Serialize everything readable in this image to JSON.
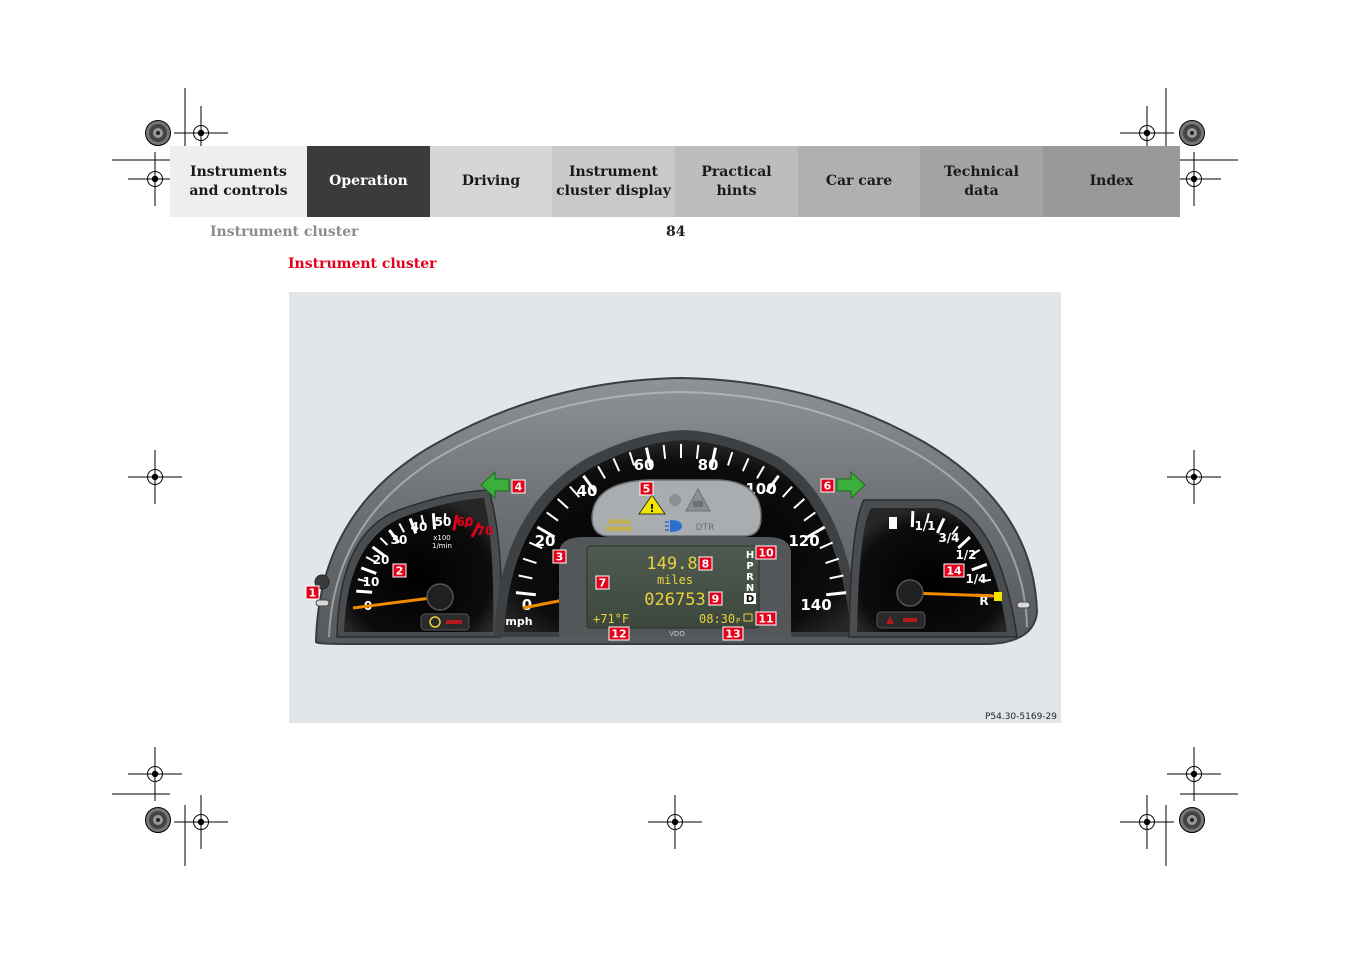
{
  "nav": {
    "tabs": [
      {
        "label": "Instruments\nand controls",
        "bg": "#eeeeee",
        "color": "#1a1a1a"
      },
      {
        "label": "Operation",
        "bg": "#3b3b3b",
        "color": "#ffffff"
      },
      {
        "label": "Driving",
        "bg": "#d6d6d6",
        "color": "#1a1a1a"
      },
      {
        "label": "Instrument\ncluster display",
        "bg": "#c9c9c9",
        "color": "#1a1a1a"
      },
      {
        "label": "Practical hints",
        "bg": "#bdbdbd",
        "color": "#1a1a1a"
      },
      {
        "label": "Car care",
        "bg": "#b0b0b0",
        "color": "#1a1a1a"
      },
      {
        "label": "Technical\ndata",
        "bg": "#a4a4a4",
        "color": "#1a1a1a"
      },
      {
        "label": "Index",
        "bg": "#999999",
        "color": "#1a1a1a"
      }
    ]
  },
  "header": {
    "running_title": "Instrument cluster",
    "page_number": "84"
  },
  "section": {
    "heading": "Instrument cluster"
  },
  "figure": {
    "caption_code": "P54.30-5169-29",
    "brand": "VDO",
    "tachometer": {
      "labels": [
        "0",
        "10",
        "20",
        "30",
        "40",
        "50",
        "60",
        "70"
      ],
      "unit_line1": "x100",
      "unit_line2": "1/min",
      "red_from": "60"
    },
    "speedometer": {
      "labels": [
        "0",
        "20",
        "40",
        "60",
        "80",
        "100",
        "120",
        "140"
      ],
      "unit": "mph"
    },
    "fuel_gauge": {
      "labels": [
        "1/1",
        "3/4",
        "1/2",
        "1/4",
        "R"
      ]
    },
    "warning_panel": {
      "check_engine_line1": "CHECK",
      "check_engine_line2": "ENGINE",
      "dtr": "DTR"
    },
    "display": {
      "trip": "149.8",
      "unit": "miles",
      "odometer": "026753",
      "temperature": "+71°F",
      "time": "08:30",
      "time_suffix": "P",
      "gears": [
        "H",
        "P",
        "R",
        "N",
        "D"
      ]
    },
    "callouts": [
      "1",
      "2",
      "3",
      "4",
      "5",
      "6",
      "7",
      "8",
      "9",
      "10",
      "11",
      "12",
      "13",
      "14"
    ],
    "colors": {
      "callout": "#e2001a",
      "needle": "#f28a00",
      "arrow": "#3cae3c",
      "lcd": "#e8d23c"
    }
  }
}
